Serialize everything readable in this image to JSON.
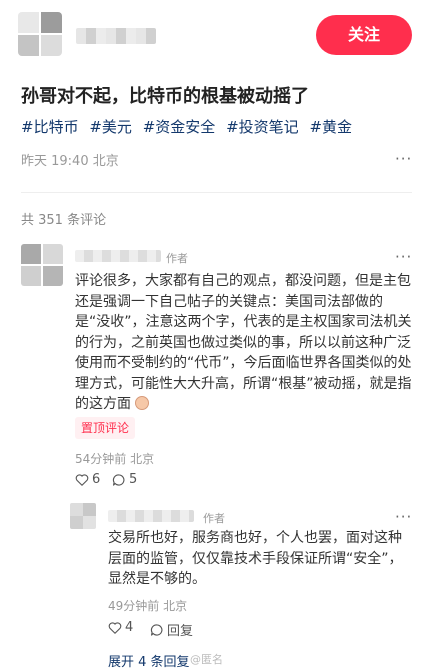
{
  "header": {
    "follow_label": "关注"
  },
  "post": {
    "title": "孙哥对不起，比特币的根基被动摇了",
    "tags": [
      "#比特币",
      "#美元",
      "#资金安全",
      "#投资笔记",
      "#黄金"
    ],
    "time_location": "昨天 19:40 北京",
    "more_icon": "more-dots-icon"
  },
  "comments_header": {
    "count_text": "共 351 条评论"
  },
  "comment": {
    "author_tag": "作者",
    "text": "评论很多，大家都有自己的观点，都没问题，但是主包还是强调一下自己帖子的关键点：美国司法部做的是“没收”，注意这两个字，代表的是主权国家司法机关的行为，之前英国也做过类似的事，所以以前这种广泛使用而不受制约的“代币”，今后面临世界各国类似的处理方式，可能性大大升高，所谓“根基”被动摇，就是指的这方面",
    "pin_label": "置顶评论",
    "time_location": "54分钟前 北京",
    "likes": "6",
    "replies": "5"
  },
  "reply": {
    "author_tag": "作者",
    "text": "交易所也好，服务商也好，个人也罢，面对这种层面的监管，仅仅靠技术手段保证所谓“安全”，显然是不够的。",
    "time_location": "49分钟前 北京",
    "likes": "4",
    "reply_label": "回复"
  },
  "expand_label": "展开 4 条回复",
  "watermark": "@匿名"
}
